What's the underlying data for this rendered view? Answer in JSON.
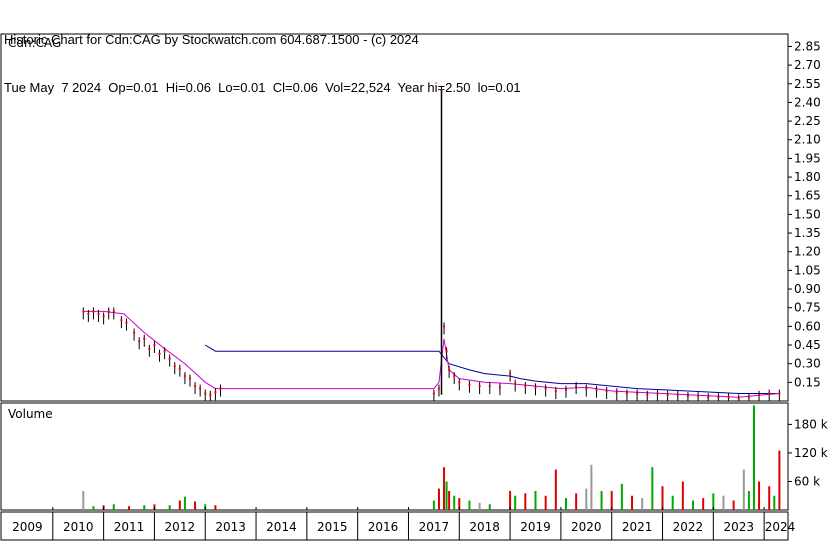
{
  "header": {
    "line1": "Historic Chart for Cdn:CAG by Stockwatch.com 604.687.1500 - (c) 2024",
    "line2": "Tue May  7 2024  Op=0.01  Hi=0.06  Lo=0.01  Cl=0.06  Vol=22,524  Year hi=2.50  lo=0.01"
  },
  "colors": {
    "price_bar": "#000000",
    "close_dot": "#ff0000",
    "ma_short": "#cc00cc",
    "ma_long": "#000099",
    "vol_up": "#00aa00",
    "vol_down": "#dd0000",
    "vol_flat": "#999999",
    "grid": "#000000"
  },
  "chart_data": [
    {
      "type": "line",
      "title": "Cdn:CAG",
      "ylim": [
        0,
        2.95
      ],
      "yticks": [
        "2.85",
        "2.70",
        "2.55",
        "2.40",
        "2.25",
        "2.10",
        "1.95",
        "1.80",
        "1.65",
        "1.50",
        "1.35",
        "1.20",
        "1.05",
        "0.90",
        "0.75",
        "0.60",
        "0.45",
        "0.30",
        "0.15"
      ],
      "ytick_values": [
        2.85,
        2.7,
        2.55,
        2.4,
        2.25,
        2.1,
        1.95,
        1.8,
        1.65,
        1.5,
        1.35,
        1.2,
        1.05,
        0.9,
        0.75,
        0.6,
        0.45,
        0.3,
        0.15
      ],
      "x_labels": [
        "2009",
        "2010",
        "2011",
        "2012",
        "2013",
        "2014",
        "2015",
        "2016",
        "2017",
        "2018",
        "2019",
        "2020",
        "2021",
        "2022",
        "2023",
        "2024"
      ],
      "series": [
        {
          "style": "price",
          "points": [
            [
              2010.6,
              0.72
            ],
            [
              2010.7,
              0.7
            ],
            [
              2010.8,
              0.72
            ],
            [
              2010.9,
              0.7
            ],
            [
              2011.0,
              0.68
            ],
            [
              2011.1,
              0.72
            ],
            [
              2011.2,
              0.72
            ],
            [
              2011.35,
              0.65
            ],
            [
              2011.45,
              0.63
            ],
            [
              2011.6,
              0.55
            ],
            [
              2011.7,
              0.48
            ],
            [
              2011.8,
              0.5
            ],
            [
              2011.9,
              0.42
            ],
            [
              2012.0,
              0.45
            ],
            [
              2012.1,
              0.38
            ],
            [
              2012.2,
              0.4
            ],
            [
              2012.3,
              0.34
            ],
            [
              2012.4,
              0.28
            ],
            [
              2012.5,
              0.26
            ],
            [
              2012.6,
              0.2
            ],
            [
              2012.7,
              0.18
            ],
            [
              2012.8,
              0.12
            ],
            [
              2012.9,
              0.1
            ],
            [
              2013.0,
              0.06
            ],
            [
              2013.1,
              0.05
            ],
            [
              2013.2,
              0.07
            ],
            [
              2013.3,
              0.1
            ],
            [
              2017.5,
              0.06
            ],
            [
              2017.6,
              0.1
            ],
            [
              2017.65,
              2.5
            ],
            [
              2017.7,
              0.6
            ],
            [
              2017.75,
              0.4
            ],
            [
              2017.8,
              0.25
            ],
            [
              2017.9,
              0.2
            ],
            [
              2018.0,
              0.15
            ],
            [
              2018.2,
              0.13
            ],
            [
              2018.4,
              0.12
            ],
            [
              2018.6,
              0.12
            ],
            [
              2018.8,
              0.11
            ],
            [
              2019.0,
              0.22
            ],
            [
              2019.1,
              0.14
            ],
            [
              2019.3,
              0.12
            ],
            [
              2019.5,
              0.11
            ],
            [
              2019.7,
              0.1
            ],
            [
              2019.9,
              0.08
            ],
            [
              2020.1,
              0.09
            ],
            [
              2020.3,
              0.12
            ],
            [
              2020.5,
              0.1
            ],
            [
              2020.7,
              0.09
            ],
            [
              2020.9,
              0.08
            ],
            [
              2021.1,
              0.07
            ],
            [
              2021.3,
              0.06
            ],
            [
              2021.5,
              0.06
            ],
            [
              2021.7,
              0.05
            ],
            [
              2021.9,
              0.06
            ],
            [
              2022.1,
              0.05
            ],
            [
              2022.3,
              0.05
            ],
            [
              2022.5,
              0.04
            ],
            [
              2022.7,
              0.04
            ],
            [
              2022.9,
              0.03
            ],
            [
              2023.1,
              0.03
            ],
            [
              2023.3,
              0.03
            ],
            [
              2023.5,
              0.02
            ],
            [
              2023.7,
              0.03
            ],
            [
              2023.9,
              0.05
            ],
            [
              2024.1,
              0.06
            ],
            [
              2024.3,
              0.06
            ]
          ]
        },
        {
          "style": "ma_short",
          "points": [
            [
              2010.6,
              0.72
            ],
            [
              2011.0,
              0.72
            ],
            [
              2011.4,
              0.7
            ],
            [
              2011.8,
              0.55
            ],
            [
              2012.2,
              0.42
            ],
            [
              2012.6,
              0.3
            ],
            [
              2013.0,
              0.15
            ],
            [
              2013.2,
              0.1
            ],
            [
              2013.3,
              0.1
            ],
            [
              2017.5,
              0.1
            ],
            [
              2017.6,
              0.15
            ],
            [
              2017.7,
              0.5
            ],
            [
              2017.8,
              0.25
            ],
            [
              2018.0,
              0.18
            ],
            [
              2018.5,
              0.15
            ],
            [
              2019.0,
              0.14
            ],
            [
              2019.5,
              0.12
            ],
            [
              2020.0,
              0.1
            ],
            [
              2020.5,
              0.11
            ],
            [
              2021.0,
              0.08
            ],
            [
              2021.5,
              0.07
            ],
            [
              2022.0,
              0.06
            ],
            [
              2022.5,
              0.05
            ],
            [
              2023.0,
              0.04
            ],
            [
              2023.5,
              0.03
            ],
            [
              2024.0,
              0.05
            ],
            [
              2024.3,
              0.06
            ]
          ]
        },
        {
          "style": "ma_long",
          "points": [
            [
              2013.0,
              0.45
            ],
            [
              2013.2,
              0.4
            ],
            [
              2017.5,
              0.4
            ],
            [
              2017.6,
              0.4
            ],
            [
              2017.7,
              0.35
            ],
            [
              2017.8,
              0.3
            ],
            [
              2018.2,
              0.25
            ],
            [
              2018.5,
              0.22
            ],
            [
              2019.0,
              0.2
            ],
            [
              2019.2,
              0.18
            ],
            [
              2019.5,
              0.16
            ],
            [
              2020.0,
              0.14
            ],
            [
              2020.5,
              0.14
            ],
            [
              2021.0,
              0.12
            ],
            [
              2021.5,
              0.1
            ],
            [
              2022.0,
              0.09
            ],
            [
              2022.5,
              0.08
            ],
            [
              2023.0,
              0.07
            ],
            [
              2023.5,
              0.06
            ],
            [
              2024.0,
              0.06
            ],
            [
              2024.3,
              0.06
            ]
          ]
        }
      ]
    },
    {
      "type": "bar",
      "title": "Volume",
      "ylim": [
        0,
        225
      ],
      "ytick_labels": [
        "180 k",
        "120 k",
        "60 k"
      ],
      "ytick_values": [
        180,
        120,
        60
      ],
      "bars": [
        [
          2010.6,
          40,
          "flat"
        ],
        [
          2010.8,
          8,
          "up"
        ],
        [
          2011.0,
          10,
          "down"
        ],
        [
          2011.2,
          12,
          "up"
        ],
        [
          2011.5,
          8,
          "down"
        ],
        [
          2011.8,
          10,
          "up"
        ],
        [
          2012.0,
          12,
          "down"
        ],
        [
          2012.3,
          10,
          "up"
        ],
        [
          2012.5,
          20,
          "down"
        ],
        [
          2012.6,
          28,
          "up"
        ],
        [
          2012.8,
          18,
          "down"
        ],
        [
          2013.0,
          12,
          "up"
        ],
        [
          2013.2,
          10,
          "down"
        ],
        [
          2017.5,
          20,
          "up"
        ],
        [
          2017.6,
          45,
          "down"
        ],
        [
          2017.7,
          90,
          "down"
        ],
        [
          2017.75,
          60,
          "up"
        ],
        [
          2017.8,
          40,
          "down"
        ],
        [
          2017.9,
          30,
          "up"
        ],
        [
          2018.0,
          25,
          "down"
        ],
        [
          2018.2,
          20,
          "up"
        ],
        [
          2018.4,
          15,
          "flat"
        ],
        [
          2018.6,
          12,
          "up"
        ],
        [
          2019.0,
          40,
          "down"
        ],
        [
          2019.1,
          30,
          "up"
        ],
        [
          2019.3,
          35,
          "down"
        ],
        [
          2019.5,
          40,
          "up"
        ],
        [
          2019.7,
          30,
          "down"
        ],
        [
          2019.9,
          85,
          "down"
        ],
        [
          2020.1,
          25,
          "up"
        ],
        [
          2020.3,
          35,
          "down"
        ],
        [
          2020.5,
          45,
          "flat"
        ],
        [
          2020.6,
          95,
          "flat"
        ],
        [
          2020.8,
          40,
          "up"
        ],
        [
          2021.0,
          40,
          "down"
        ],
        [
          2021.2,
          55,
          "up"
        ],
        [
          2021.4,
          30,
          "down"
        ],
        [
          2021.6,
          25,
          "flat"
        ],
        [
          2021.8,
          90,
          "up"
        ],
        [
          2022.0,
          50,
          "down"
        ],
        [
          2022.2,
          30,
          "up"
        ],
        [
          2022.4,
          60,
          "down"
        ],
        [
          2022.6,
          20,
          "up"
        ],
        [
          2022.8,
          25,
          "down"
        ],
        [
          2023.0,
          35,
          "up"
        ],
        [
          2023.2,
          30,
          "flat"
        ],
        [
          2023.4,
          20,
          "down"
        ],
        [
          2023.6,
          85,
          "flat"
        ],
        [
          2023.7,
          40,
          "up"
        ],
        [
          2023.8,
          220,
          "up"
        ],
        [
          2023.9,
          60,
          "down"
        ],
        [
          2024.1,
          50,
          "down"
        ],
        [
          2024.2,
          30,
          "up"
        ],
        [
          2024.3,
          125,
          "down"
        ]
      ]
    }
  ]
}
